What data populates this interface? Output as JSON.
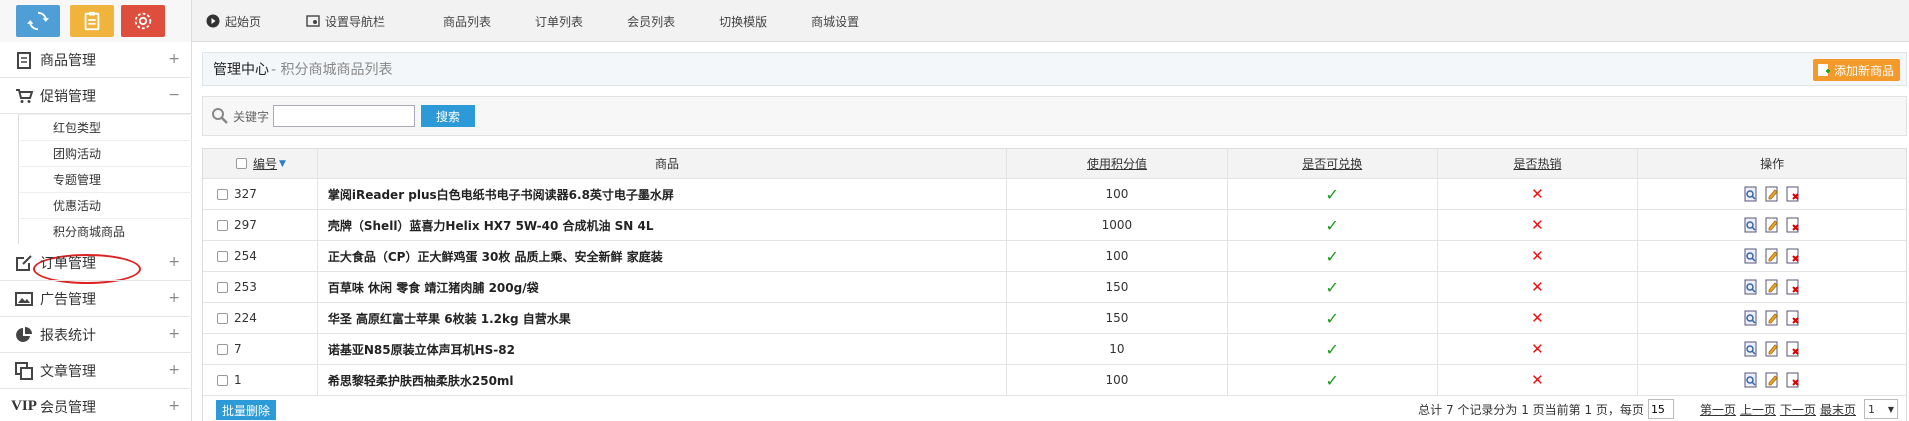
{
  "topnav": [
    {
      "label": "起始页",
      "icon": "play-circle-icon"
    },
    {
      "label": "设置导航栏",
      "icon": "settings-nav-icon"
    },
    {
      "label": "商品列表",
      "icon": ""
    },
    {
      "label": "订单列表",
      "icon": ""
    },
    {
      "label": "会员列表",
      "icon": ""
    },
    {
      "label": "切换模版",
      "icon": ""
    },
    {
      "label": "商城设置",
      "icon": ""
    }
  ],
  "sidebar": {
    "menus": [
      {
        "label": "商品管理",
        "toggle": "+"
      },
      {
        "label": "促销管理",
        "toggle": "−"
      },
      {
        "label": "订单管理",
        "toggle": "+"
      },
      {
        "label": "广告管理",
        "toggle": "+"
      },
      {
        "label": "报表统计",
        "toggle": "+"
      },
      {
        "label": "文章管理",
        "toggle": "+"
      },
      {
        "label": "会员管理",
        "toggle": "+"
      }
    ],
    "vip_text": "VIP",
    "promo_sub": [
      "红包类型",
      "团购活动",
      "专题管理",
      "优惠活动",
      "积分商城商品"
    ]
  },
  "main": {
    "title": "管理中心",
    "subtitle": "- 积分商城商品列表",
    "add_button": "添加新商品",
    "search": {
      "label": "关键字",
      "value": "",
      "button": "搜索"
    },
    "columns": {
      "id": "编号",
      "name": "商品",
      "points": "使用积分值",
      "exchange": "是否可兑换",
      "hot": "是否热销",
      "ops": "操作"
    },
    "rows": [
      {
        "id": "327",
        "name": "掌阅iReader plus白色电纸书电子书阅读器6.8英寸电子墨水屏",
        "points": "100",
        "exchange": "✓",
        "hot": "✕"
      },
      {
        "id": "297",
        "name": "壳牌（Shell）蓝喜力Helix HX7 5W-40 合成机油 SN 4L",
        "points": "1000",
        "exchange": "✓",
        "hot": "✕"
      },
      {
        "id": "254",
        "name": "正大食品（CP）正大鲜鸡蛋 30枚 品质上乘、安全新鲜 家庭装",
        "points": "100",
        "exchange": "✓",
        "hot": "✕"
      },
      {
        "id": "253",
        "name": "百草味 休闲 零食 靖江猪肉脯 200g/袋",
        "points": "150",
        "exchange": "✓",
        "hot": "✕"
      },
      {
        "id": "224",
        "name": "华圣 高原红富士苹果 6枚装 1.2kg 自营水果",
        "points": "150",
        "exchange": "✓",
        "hot": "✕"
      },
      {
        "id": "7",
        "name": "诺基亚N85原装立体声耳机HS-82",
        "points": "10",
        "exchange": "✓",
        "hot": "✕"
      },
      {
        "id": "1",
        "name": "希思黎轻柔护肤西柚柔肤水250ml",
        "points": "100",
        "exchange": "✓",
        "hot": "✕"
      }
    ],
    "batch_delete": "批量删除",
    "pager": {
      "summary": "总计 7 个记录分为 1 页当前第 1 页，每页",
      "per_page": "15",
      "first": "第一页",
      "prev": "上一页",
      "next": "下一页",
      "last": "最末页",
      "page": "1"
    }
  }
}
